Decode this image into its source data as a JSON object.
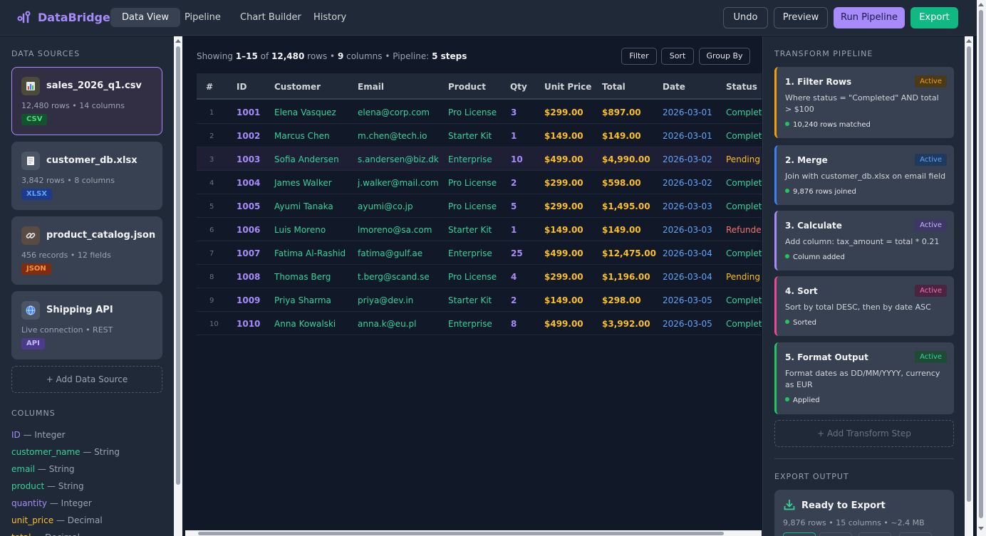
{
  "app": {
    "name": "DataBridge"
  },
  "nav": {
    "tabs": [
      "Data View",
      "Pipeline",
      "Chart Builder",
      "History"
    ],
    "active": "Data View"
  },
  "toolbar": {
    "undo": "Undo",
    "preview": "Preview",
    "run": "Run Pipeline",
    "export": "Export"
  },
  "sidebar": {
    "sources_title": "DATA SOURCES",
    "sources": [
      {
        "name": "sales_2026_q1.csv",
        "meta": "12,480 rows • 14 columns",
        "badge": "CSV",
        "icon": "bar-chart-icon"
      },
      {
        "name": "customer_db.xlsx",
        "meta": "3,842 rows • 8 columns",
        "badge": "XLSX",
        "icon": "document-icon"
      },
      {
        "name": "product_catalog.json",
        "meta": "456 records • 12 fields",
        "badge": "JSON",
        "icon": "link-icon"
      },
      {
        "name": "Shipping API",
        "meta": "Live connection • REST",
        "badge": "API",
        "icon": "globe-icon"
      }
    ],
    "add_source": "+ Add Data Source",
    "columns_title": "COLUMNS",
    "columns": [
      {
        "name": "ID",
        "type": " — Integer",
        "color": "#a78bfa"
      },
      {
        "name": "customer_name",
        "type": " — String",
        "color": "#34d399"
      },
      {
        "name": "email",
        "type": " — String",
        "color": "#34d399"
      },
      {
        "name": "product",
        "type": " — String",
        "color": "#34d399"
      },
      {
        "name": "quantity",
        "type": " — Integer",
        "color": "#a78bfa"
      },
      {
        "name": "unit_price",
        "type": " — Decimal",
        "color": "#fbbf24"
      },
      {
        "name": "total",
        "type": " — Decimal",
        "color": "#fbbf24"
      }
    ]
  },
  "main": {
    "info": {
      "prefix": "Showing ",
      "range": "1–15",
      "of": " of ",
      "rows": "12,480",
      "rows_label": " rows • ",
      "columns": "9",
      "columns_label": " columns • Pipeline: ",
      "steps": "5 steps"
    },
    "buttons": {
      "filter": "Filter",
      "sort": "Sort",
      "group_by": "Group By"
    },
    "headers": [
      "#",
      "ID",
      "Customer",
      "Email",
      "Product",
      "Qty",
      "Unit Price",
      "Total",
      "Date",
      "Status"
    ],
    "rows": [
      [
        "1",
        "1001",
        "Elena Vasquez",
        "elena@corp.com",
        "Pro License",
        "3",
        "$299.00",
        "$897.00",
        "2026-03-01",
        "Completed"
      ],
      [
        "2",
        "1002",
        "Marcus Chen",
        "m.chen@tech.io",
        "Starter Kit",
        "1",
        "$149.00",
        "$149.00",
        "2026-03-01",
        "Completed"
      ],
      [
        "3",
        "1003",
        "Sofia Andersen",
        "s.andersen@biz.dk",
        "Enterprise",
        "10",
        "$499.00",
        "$4,990.00",
        "2026-03-02",
        "Pending"
      ],
      [
        "4",
        "1004",
        "James Walker",
        "j.walker@mail.com",
        "Pro License",
        "2",
        "$299.00",
        "$598.00",
        "2026-03-02",
        "Completed"
      ],
      [
        "5",
        "1005",
        "Ayumi Tanaka",
        "ayumi@co.jp",
        "Pro License",
        "5",
        "$299.00",
        "$1,495.00",
        "2026-03-03",
        "Completed"
      ],
      [
        "6",
        "1006",
        "Luis Moreno",
        "lmoreno@sa.com",
        "Starter Kit",
        "1",
        "$149.00",
        "$149.00",
        "2026-03-03",
        "Refunded"
      ],
      [
        "7",
        "1007",
        "Fatima Al-Rashid",
        "fatima@gulf.ae",
        "Enterprise",
        "25",
        "$499.00",
        "$12,475.00",
        "2026-03-04",
        "Completed"
      ],
      [
        "8",
        "1008",
        "Thomas Berg",
        "t.berg@scand.se",
        "Pro License",
        "4",
        "$299.00",
        "$1,196.00",
        "2026-03-04",
        "Pending"
      ],
      [
        "9",
        "1009",
        "Priya Sharma",
        "priya@dev.in",
        "Starter Kit",
        "2",
        "$149.00",
        "$298.00",
        "2026-03-05",
        "Completed"
      ],
      [
        "10",
        "1010",
        "Anna Kowalski",
        "anna.k@eu.pl",
        "Enterprise",
        "8",
        "$499.00",
        "$3,992.00",
        "2026-03-05",
        "Completed"
      ]
    ]
  },
  "pipeline": {
    "title": "TRANSFORM PIPELINE",
    "steps": [
      {
        "title": "1. Filter Rows",
        "badge": "Active",
        "desc": "Where status = \"Completed\" AND total > $100",
        "status": "10,240 rows matched",
        "color": "#f59e0b",
        "badge_bg": "#4a3a1a",
        "badge_fg": "#f59e0b"
      },
      {
        "title": "2. Merge",
        "badge": "Active",
        "desc": "Join with customer_db.xlsx on email field",
        "status": "9,876 rows joined",
        "color": "#3b82f6",
        "badge_bg": "#1e3a5f",
        "badge_fg": "#60a5fa"
      },
      {
        "title": "3. Calculate",
        "badge": "Active",
        "desc": "Add column: tax_amount = total * 0.21",
        "status": "Column added",
        "color": "#a78bfa",
        "badge_bg": "#3d3766",
        "badge_fg": "#c4b5fd"
      },
      {
        "title": "4. Sort",
        "badge": "Active",
        "desc": "Sort by total DESC, then by date ASC",
        "status": "Sorted",
        "color": "#ec4899",
        "badge_bg": "#4a2440",
        "badge_fg": "#f472b6"
      },
      {
        "title": "5. Format Output",
        "badge": "Active",
        "desc": "Format dates as DD/MM/YYYY, currency as EUR",
        "status": "Applied",
        "color": "#22c55e",
        "badge_bg": "#1f4a33",
        "badge_fg": "#34d399"
      }
    ],
    "add_step": "+ Add Transform Step",
    "export_title": "EXPORT OUTPUT",
    "export_card": {
      "title": "Ready to Export",
      "meta": "9,876 rows • 15 columns • ~2.4 MB"
    }
  }
}
